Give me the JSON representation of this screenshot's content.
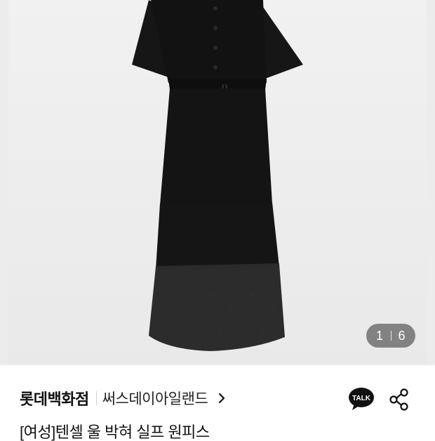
{
  "image_counter": {
    "current": "1",
    "total": "6"
  },
  "store": {
    "name": "롯데백화점",
    "brand": "써스데이아일랜드"
  },
  "actions": {
    "talk_label": "TALK"
  },
  "product": {
    "title": "[여성]텐셀 울 박혀 실프 원피스"
  },
  "icons": [
    "chevron-right-icon",
    "kakao-talk-icon",
    "share-icon"
  ],
  "colors": {
    "dress": "#141414",
    "background": "#ececec",
    "counter_pill": "#5a5a5a"
  }
}
